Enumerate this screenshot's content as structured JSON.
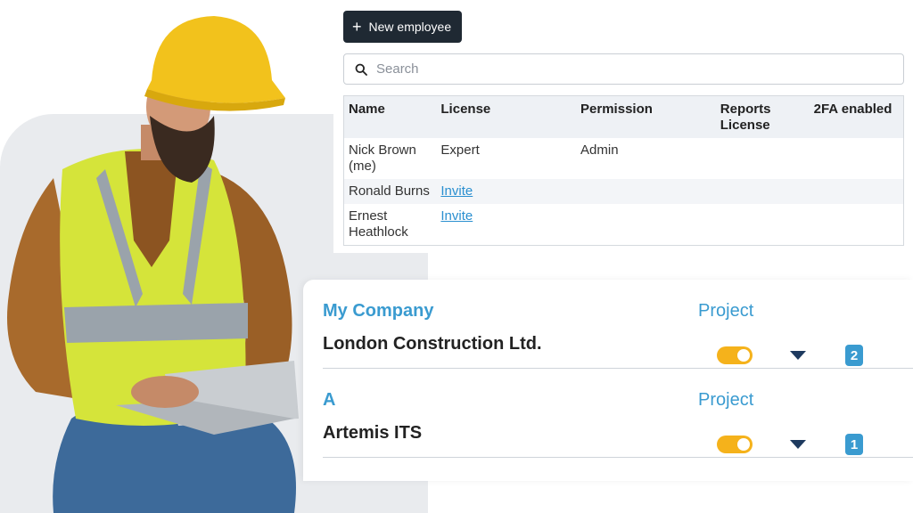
{
  "toolbar": {
    "new_employee_label": "New employee"
  },
  "search": {
    "placeholder": "Search"
  },
  "table": {
    "headers": {
      "name": "Name",
      "license": "License",
      "permission": "Permission",
      "reports_license": "Reports License",
      "twofa": "2FA enabled"
    },
    "rows": [
      {
        "name": "Nick Brown (me)",
        "license": "Expert",
        "permission": "Admin",
        "reports_license": "",
        "twofa": ""
      },
      {
        "name": "Ronald Burns",
        "license": "Invite",
        "permission": "",
        "reports_license": "",
        "twofa": ""
      },
      {
        "name": "Ernest Heathlock",
        "license": "Invite",
        "permission": "",
        "reports_license": "",
        "twofa": ""
      }
    ]
  },
  "companies": [
    {
      "group": "My Company",
      "project_label": "Project",
      "name": "London Construction Ltd.",
      "toggle_on": true,
      "count": "2"
    },
    {
      "group": "A",
      "project_label": "Project",
      "name": "Artemis ITS",
      "toggle_on": true,
      "count": "1"
    }
  ],
  "colors": {
    "accent": "#3a9bd0",
    "toggle": "#f5b21b",
    "button": "#1f2933",
    "caret": "#1e3a5f"
  }
}
